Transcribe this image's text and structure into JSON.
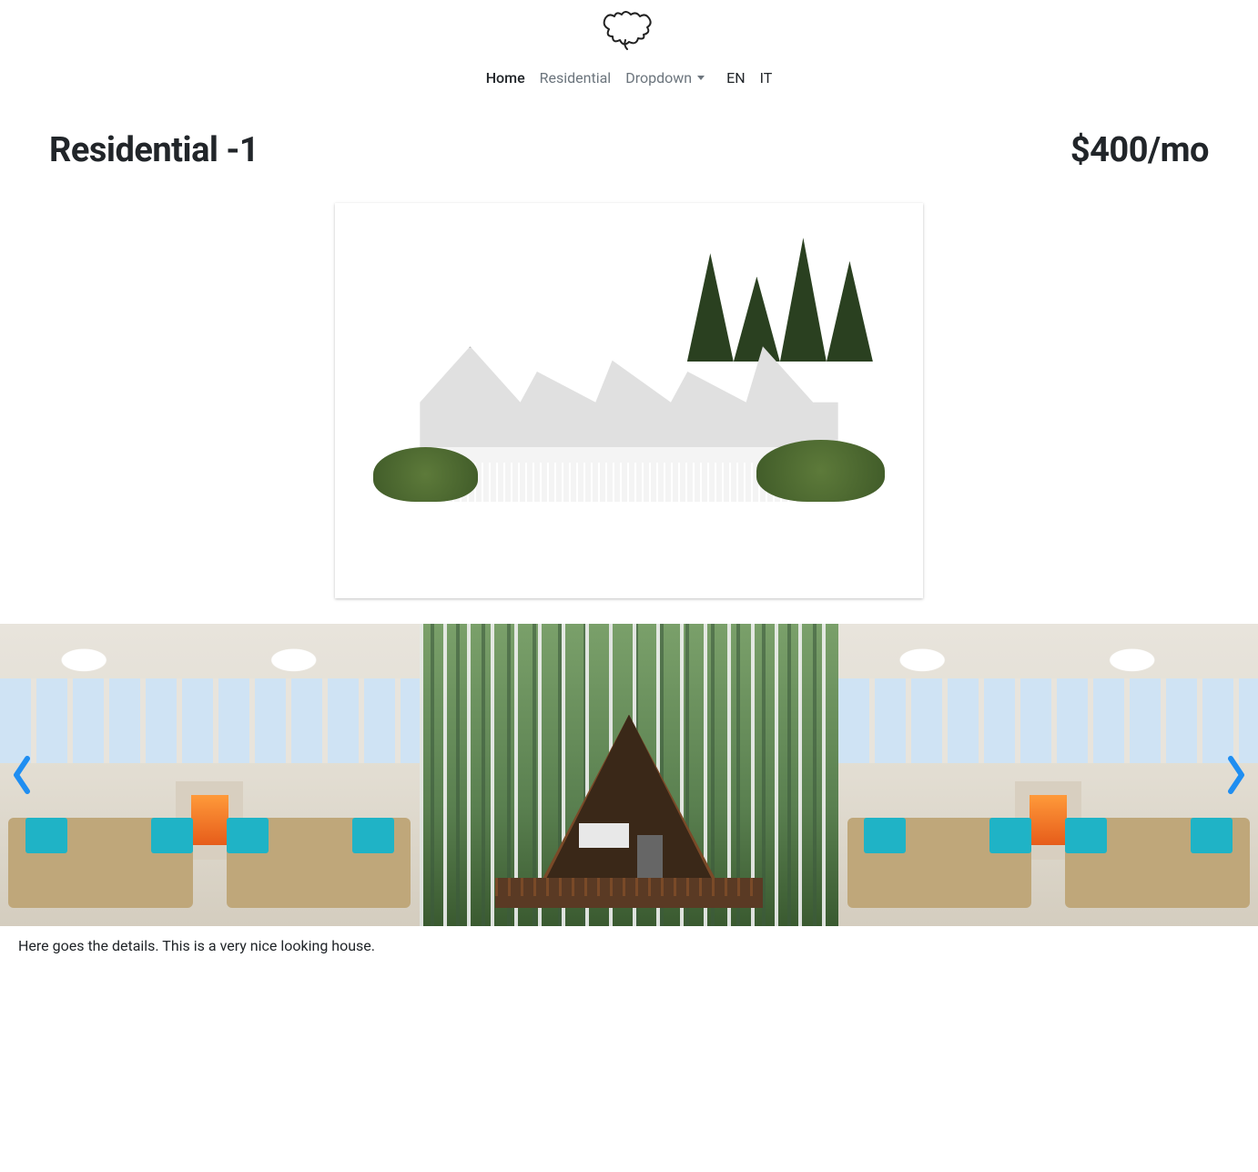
{
  "nav": {
    "home": "Home",
    "residential": "Residential",
    "dropdown": "Dropdown",
    "en": "EN",
    "it": "IT"
  },
  "listing": {
    "title": "Residential -1",
    "price": "$400/mo",
    "details": "Here goes the details. This is a very nice looking house."
  }
}
